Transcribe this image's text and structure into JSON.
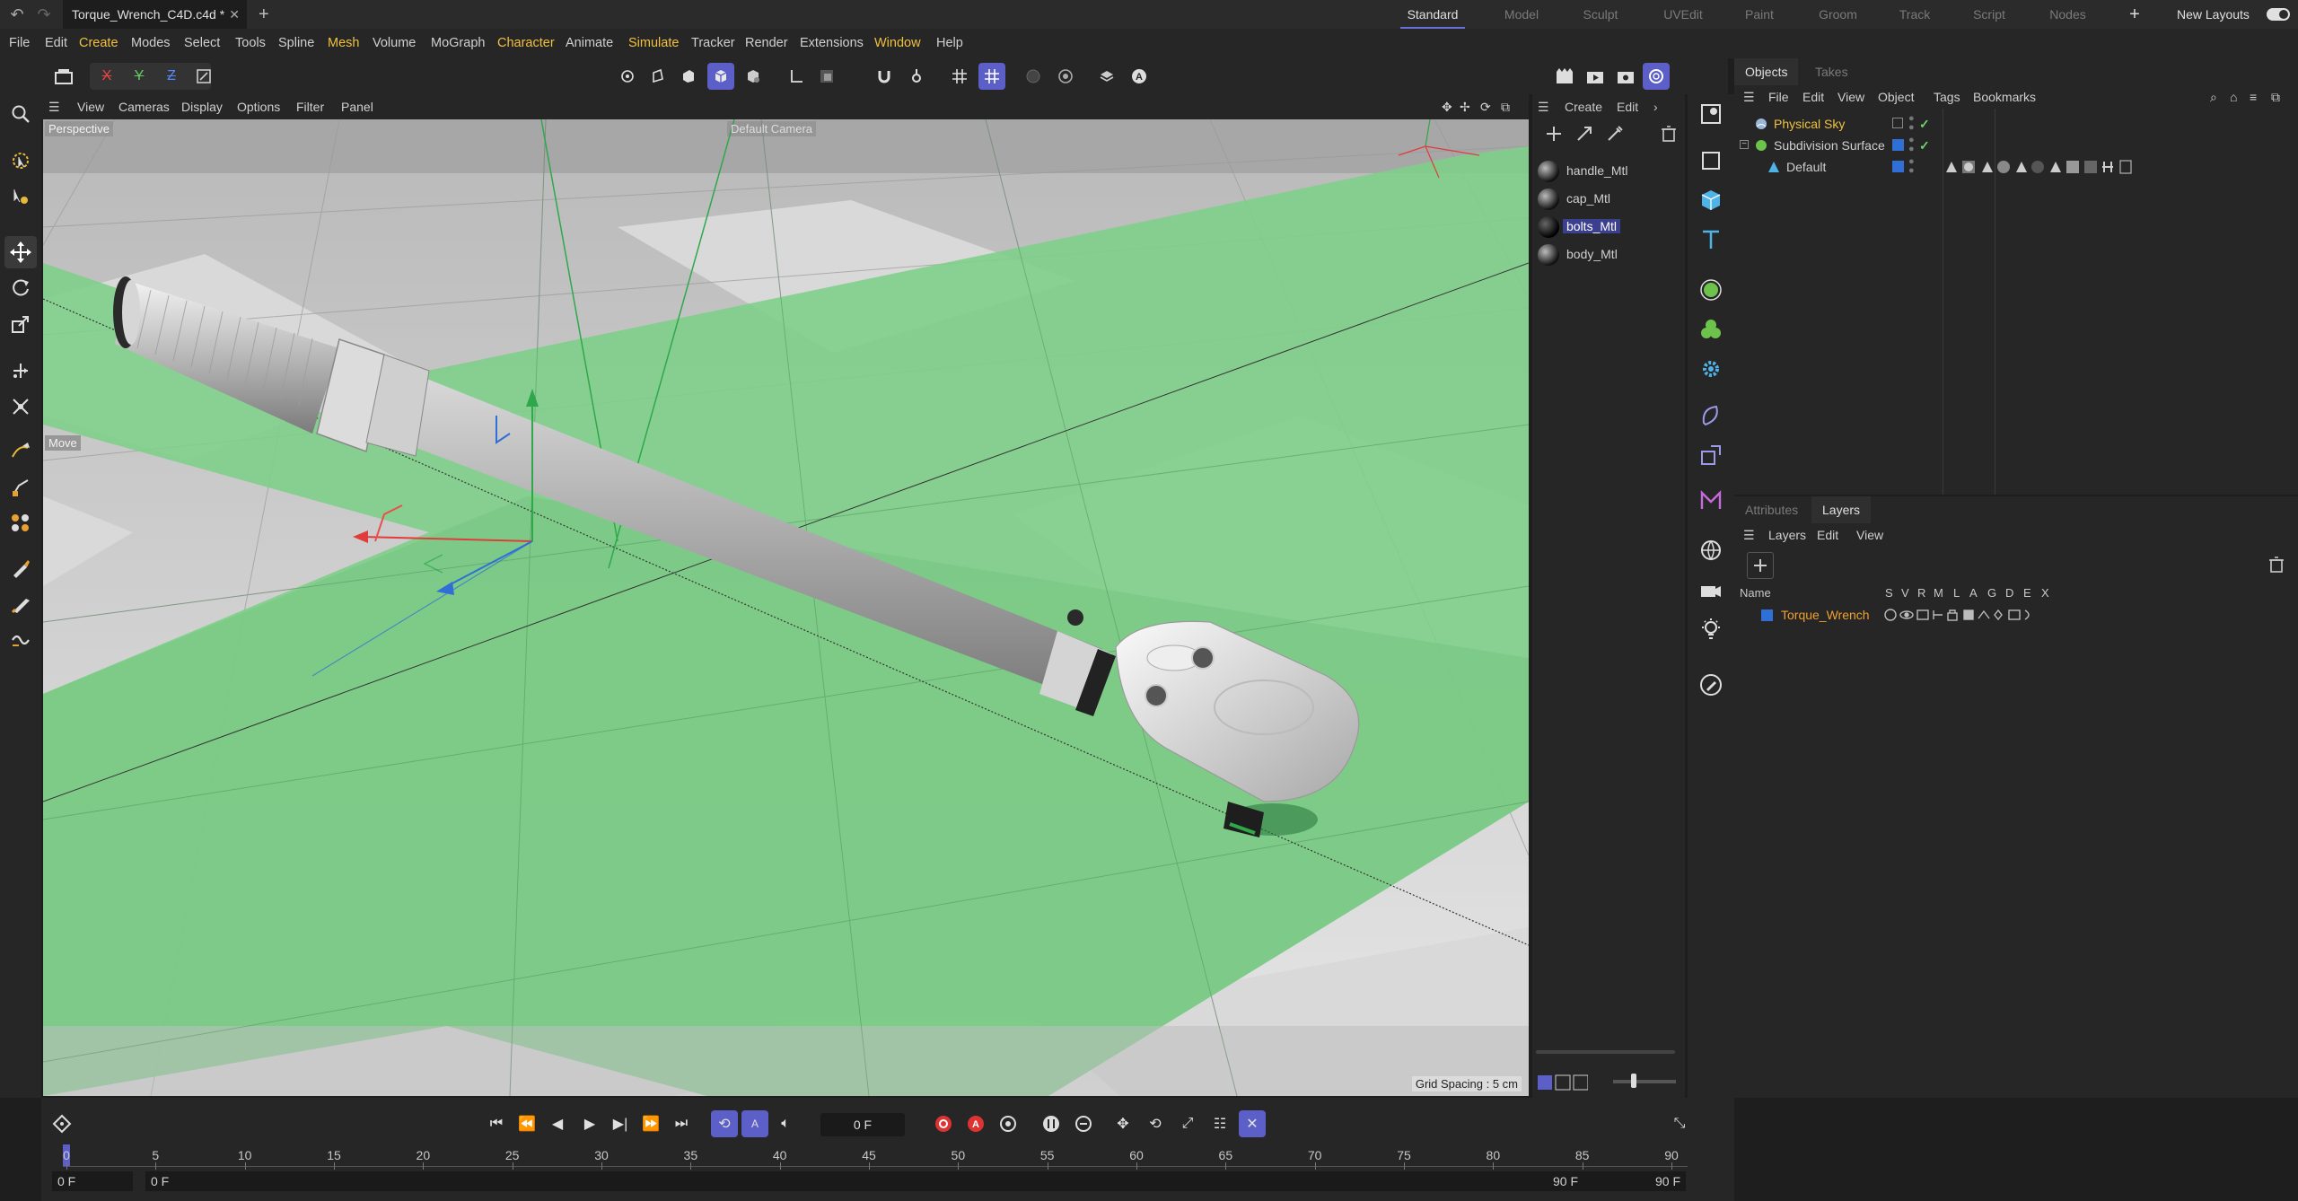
{
  "title_bar": {
    "document_tab": "Torque_Wrench_C4D.c4d *",
    "layouts": [
      "Standard",
      "Model",
      "Sculpt",
      "UVEdit",
      "Paint",
      "Groom",
      "Track",
      "Script",
      "Nodes"
    ],
    "active_layout": "Standard",
    "new_layouts": "New Layouts"
  },
  "menu": [
    "File",
    "Edit",
    "Create",
    "Modes",
    "Select",
    "Tools",
    "Spline",
    "Mesh",
    "Volume",
    "MoGraph",
    "Character",
    "Animate",
    "Simulate",
    "Tracker",
    "Render",
    "Extensions",
    "Window",
    "Help"
  ],
  "axis_buttons": [
    "X",
    "Y",
    "Z"
  ],
  "viewport": {
    "menu": [
      "View",
      "Cameras",
      "Display",
      "Options",
      "Filter",
      "Panel"
    ],
    "camera_label": "Perspective",
    "default_camera": "Default Camera",
    "tool_label": "Move",
    "grid_spacing": "Grid Spacing : 5 cm"
  },
  "materials": {
    "menu": [
      "Create",
      "Edit"
    ],
    "items": [
      {
        "name": "handle_Mtl",
        "selected": false
      },
      {
        "name": "cap_Mtl",
        "selected": false
      },
      {
        "name": "bolts_Mtl",
        "selected": true
      },
      {
        "name": "body_Mtl",
        "selected": false
      }
    ]
  },
  "objects_panel": {
    "tabs": [
      "Objects",
      "Takes"
    ],
    "menu": [
      "File",
      "Edit",
      "View",
      "Object",
      "Tags",
      "Bookmarks"
    ],
    "rows": [
      {
        "name": "Physical Sky",
        "color": "#f0c040"
      },
      {
        "name": "Subdivision Surface",
        "color": "#c8c8c8"
      },
      {
        "name": "Default",
        "color": "#c8c8c8"
      }
    ]
  },
  "layers_panel": {
    "tabs": [
      "Attributes",
      "Layers"
    ],
    "menu": [
      "Layers",
      "Edit",
      "View"
    ],
    "header": {
      "name": "Name",
      "flags": [
        "S",
        "V",
        "R",
        "M",
        "L",
        "A",
        "G",
        "D",
        "E",
        "X"
      ]
    },
    "layers": [
      {
        "name": "Torque_Wrench",
        "color": "#2f6fd6"
      }
    ]
  },
  "timeline": {
    "current_frame": "0 F",
    "ticks": [
      "0",
      "5",
      "10",
      "15",
      "20",
      "25",
      "30",
      "35",
      "40",
      "45",
      "50",
      "55",
      "60",
      "65",
      "70",
      "75",
      "80",
      "85",
      "90"
    ],
    "start_field": "0 F",
    "start_field2": "0 F",
    "end_field": "90 F",
    "end_field2": "90 F"
  },
  "colors": {
    "accent": "#5b5fc7",
    "highlight_text": "#f0c040",
    "ground_green": "#7fcf8a"
  }
}
